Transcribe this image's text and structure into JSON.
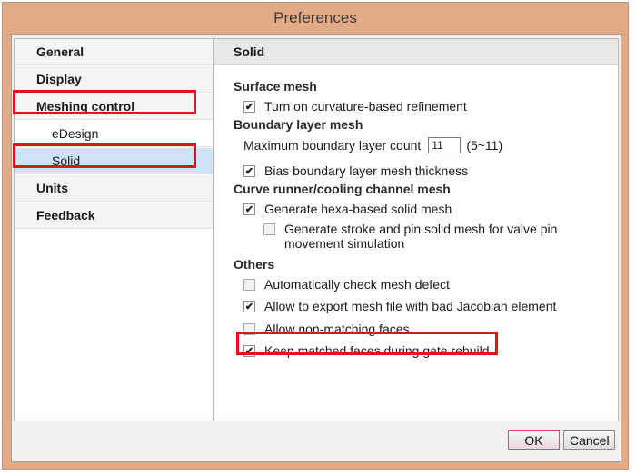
{
  "window": {
    "title": "Preferences"
  },
  "nav": {
    "items": [
      {
        "label": "General"
      },
      {
        "label": "Display"
      },
      {
        "label": "Meshing control"
      },
      {
        "label": "eDesign"
      },
      {
        "label": "Solid"
      },
      {
        "label": "Units"
      },
      {
        "label": "Feedback"
      }
    ],
    "selected": "Solid"
  },
  "content": {
    "header": "Solid",
    "surface_mesh": {
      "title": "Surface mesh",
      "curvature_label": "Turn on curvature-based refinement",
      "curvature_checked": true
    },
    "boundary_layer": {
      "title": "Boundary layer mesh",
      "max_count_label": "Maximum boundary layer count",
      "max_count_value": "11",
      "max_count_range": "(5~11)",
      "bias_label": "Bias boundary layer mesh thickness",
      "bias_checked": true
    },
    "runner": {
      "title": "Curve runner/cooling channel mesh",
      "hexa_label": "Generate hexa-based solid mesh",
      "hexa_checked": true,
      "stroke_label_line1": "Generate stroke and pin solid mesh for valve pin",
      "stroke_label_line2": "movement simulation",
      "stroke_checked": false
    },
    "others": {
      "title": "Others",
      "auto_check_label": "Automatically check mesh defect",
      "auto_check_checked": false,
      "export_label": "Allow to export mesh file with bad Jacobian element",
      "export_checked": true,
      "nonmatching_label": "Allow non-matching faces",
      "nonmatching_checked": false,
      "keep_matched_label": "Keep matched faces during gate rebuild",
      "keep_matched_checked": true
    }
  },
  "footer": {
    "ok_label": "OK",
    "cancel_label": "Cancel"
  },
  "colors": {
    "frame": "#e3aa86",
    "highlight": "#e0131a",
    "selected": "#cfe3f7"
  }
}
